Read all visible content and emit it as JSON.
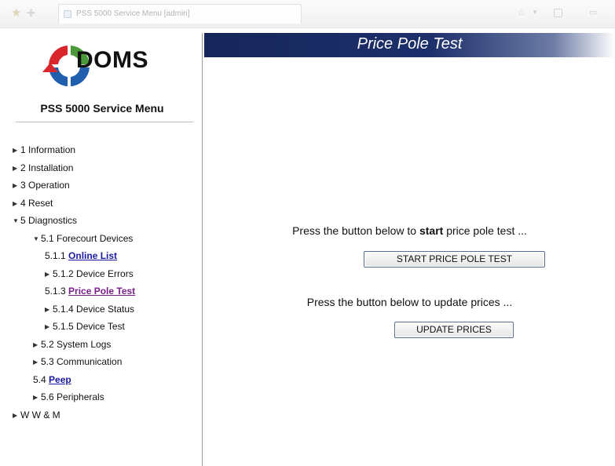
{
  "browser": {
    "tab_title": "PSS 5000 Service Menu [admin]",
    "icons": [
      "favorites-star-icon",
      "add-favorite-icon",
      "page-icon",
      "home-icon",
      "dropdown-icon",
      "feed-icon",
      "print-icon"
    ]
  },
  "sidebar": {
    "logo_text": "DOMS",
    "title": "PSS 5000 Service Menu",
    "items": [
      {
        "prefix": "1 Information",
        "link": "",
        "expander": "collapsed"
      },
      {
        "prefix": "2 Installation",
        "link": "",
        "expander": "collapsed"
      },
      {
        "prefix": "3 Operation",
        "link": "",
        "expander": "collapsed"
      },
      {
        "prefix": "4 Reset",
        "link": "",
        "expander": "collapsed"
      },
      {
        "prefix": "5 Diagnostics",
        "link": "",
        "expander": "expanded"
      },
      {
        "prefix": "5.1 Forecourt Devices",
        "link": "",
        "expander": "expanded"
      },
      {
        "prefix": "5.1.1 ",
        "link": "Online List",
        "expander": "none"
      },
      {
        "prefix": "5.1.2 Device Errors",
        "link": "",
        "expander": "collapsed"
      },
      {
        "prefix": "5.1.3 ",
        "link": "Price Pole Test",
        "expander": "none"
      },
      {
        "prefix": "5.1.4 Device Status",
        "link": "",
        "expander": "collapsed"
      },
      {
        "prefix": "5.1.5 Device Test",
        "link": "",
        "expander": "collapsed"
      },
      {
        "prefix": "5.2 System Logs",
        "link": "",
        "expander": "collapsed"
      },
      {
        "prefix": "5.3 Communication",
        "link": "",
        "expander": "collapsed"
      },
      {
        "prefix": "5.4 ",
        "link": "Peep",
        "expander": "none"
      },
      {
        "prefix": "5.6 Peripherals",
        "link": "",
        "expander": "collapsed"
      },
      {
        "prefix": "W W & M",
        "link": "",
        "expander": "collapsed"
      }
    ]
  },
  "main": {
    "title": "Price Pole Test",
    "start_prompt_before": "Press the button below to ",
    "start_prompt_bold": "start",
    "start_prompt_after": " price pole test ...",
    "start_button": "START PRICE POLE TEST",
    "update_prompt": "Press the button below to update prices ...",
    "update_button": "UPDATE PRICES"
  },
  "colors": {
    "header_navy": "#1d2f6b",
    "link": "#1a1aa0",
    "visited_link": "#7a1f8a",
    "logo_red": "#d8262c",
    "logo_green": "#4a9a3a",
    "logo_blue": "#1f5fae"
  }
}
